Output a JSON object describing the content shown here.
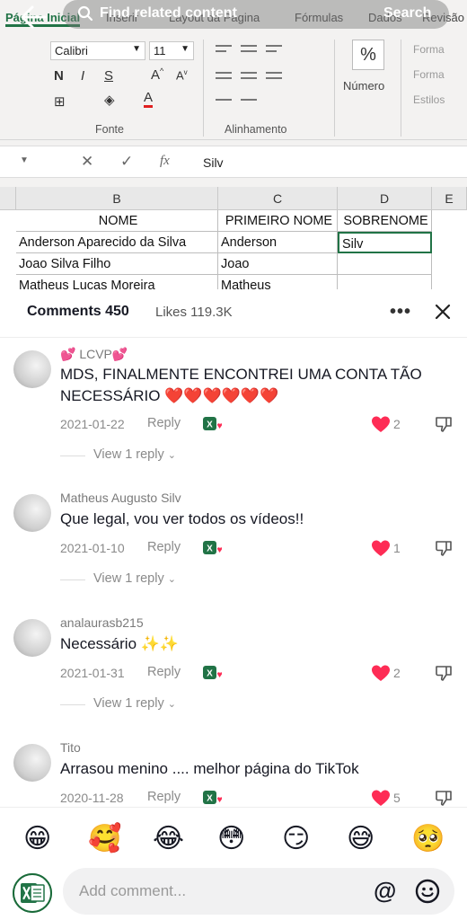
{
  "video": {
    "ribbon_tabs": [
      "Página Inicial",
      "Inserir",
      "Layout da Página",
      "Fórmulas",
      "Dados",
      "Revisão"
    ],
    "font_name": "Calibri",
    "font_size": "11",
    "group_fonte": "Fonte",
    "group_alinhamento": "Alinhamento",
    "group_numero": "Número",
    "percent": "%",
    "styles": [
      "Forma",
      "Forma",
      "Estilos"
    ],
    "fx": "fx",
    "formula_value": "Silv",
    "columns": [
      "B",
      "C",
      "D",
      "E"
    ],
    "rows": [
      [
        "NOME",
        "PRIMEIRO NOME",
        "SOBRENOME"
      ],
      [
        "Anderson Aparecido da Silva",
        "Anderson",
        "Silv"
      ],
      [
        "Joao Silva Filho",
        "Joao",
        ""
      ],
      [
        "Matheus Lucas Moreira",
        "Matheus",
        ""
      ]
    ]
  },
  "overlay": {
    "search_text": "Find related content",
    "search_button": "Search"
  },
  "panel": {
    "comments_tab": "Comments 450",
    "likes_tab": "Likes 119.3K",
    "more": "•••"
  },
  "comments": [
    {
      "user": "💕 LCVP💕",
      "text": "MDS, FINALMENTE ENCONTREI UMA CONTA TÃO NECESSÁRIO ❤️❤️❤️❤️❤️❤️",
      "date": "2021-01-22",
      "reply": "Reply",
      "likes": "2",
      "view_reply": "View 1 reply"
    },
    {
      "user": "Matheus Augusto Silv",
      "text": "Que legal, vou ver todos os vídeos!!",
      "date": "2021-01-10",
      "reply": "Reply",
      "likes": "1",
      "view_reply": "View 1 reply"
    },
    {
      "user": "analaurasb215",
      "text": "Necessário ✨✨",
      "date": "2021-01-31",
      "reply": "Reply",
      "likes": "2",
      "view_reply": "View 1 reply"
    },
    {
      "user": "Tito",
      "text": "Arrasou menino .... melhor página do TikTok",
      "date": "2020-11-28",
      "reply": "Reply",
      "likes": "5",
      "view_reply": ""
    }
  ],
  "emoji_bar": [
    "😁",
    "🥰",
    "😂",
    "😳",
    "😏",
    "😅",
    "🥺"
  ],
  "input": {
    "placeholder": "Add comment...",
    "at": "@"
  },
  "colors": {
    "heart": "#fe2c55",
    "excel_green": "#217346",
    "text_secondary": "#8a8a8a"
  }
}
